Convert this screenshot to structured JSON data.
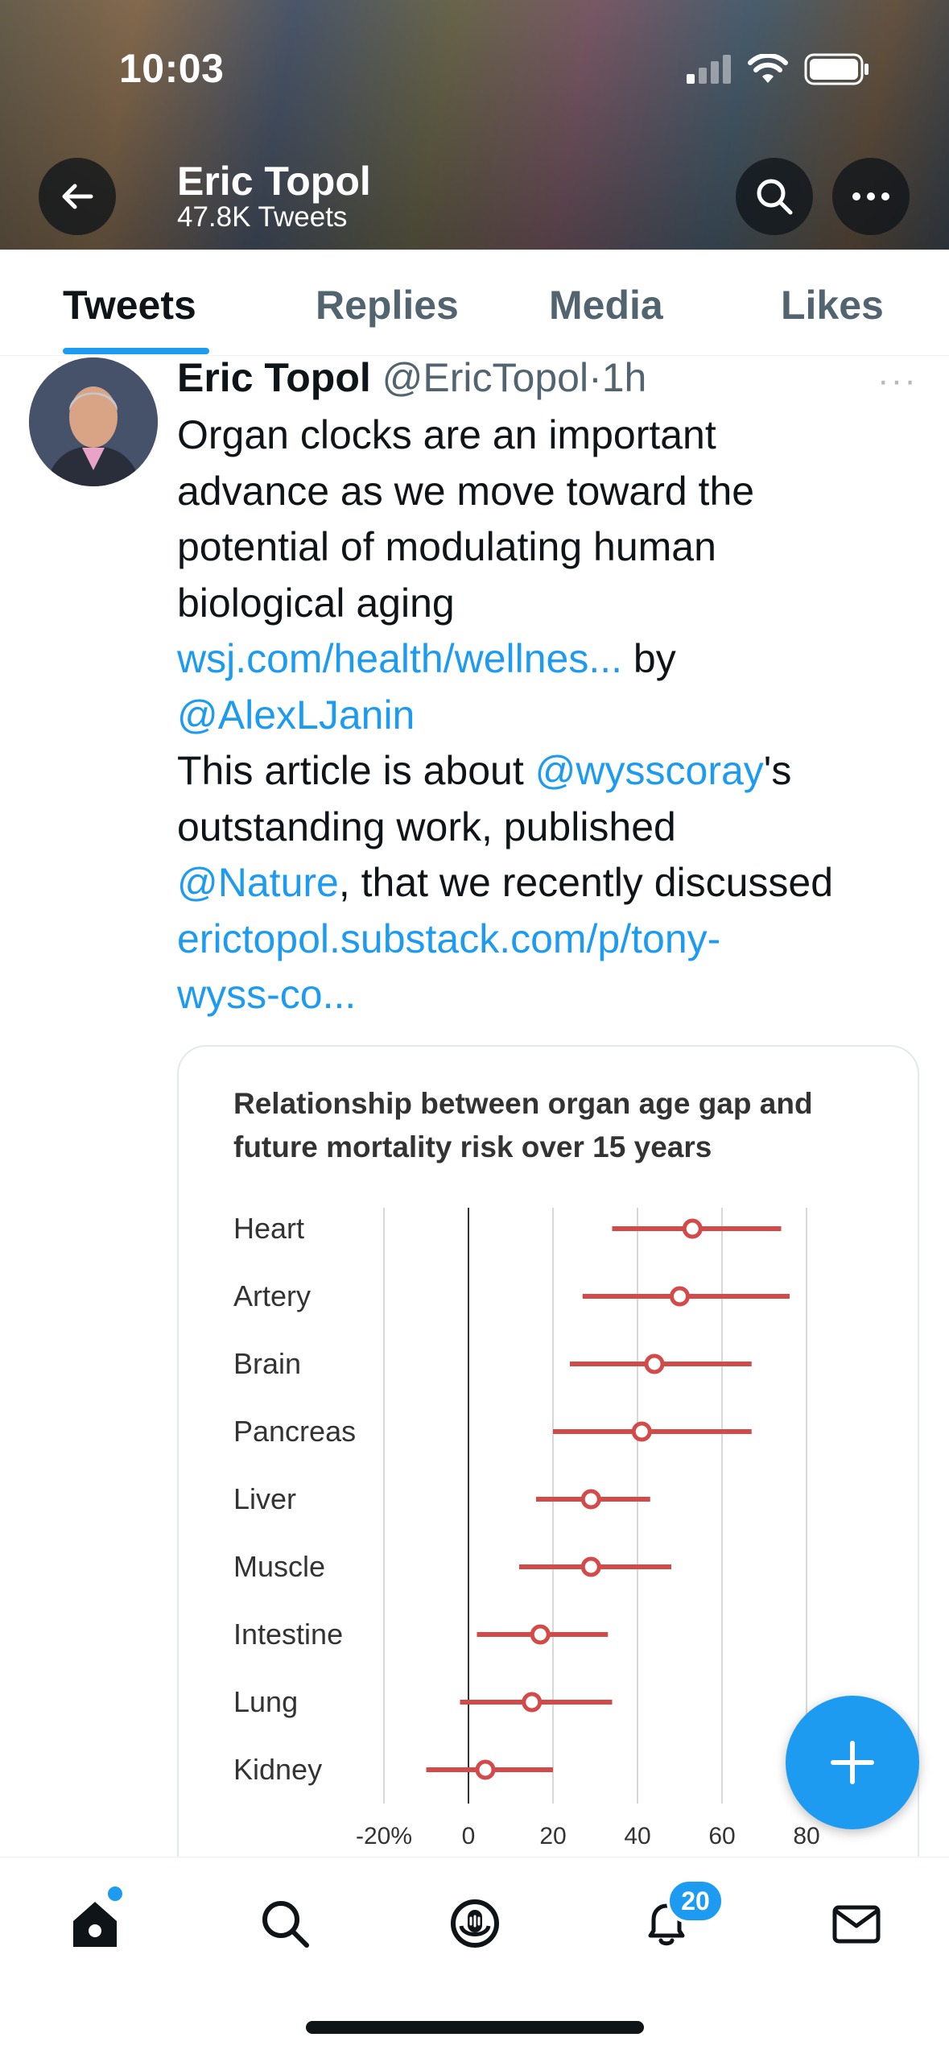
{
  "status_bar": {
    "time": "10:03"
  },
  "header": {
    "name": "Eric Topol",
    "subtitle": "47.8K Tweets"
  },
  "tabs": [
    {
      "label": "Tweets",
      "active": true
    },
    {
      "label": "Replies",
      "active": false
    },
    {
      "label": "Media",
      "active": false
    },
    {
      "label": "Likes",
      "active": false
    }
  ],
  "tweet": {
    "author_name": "Eric Topol",
    "handle": "@EricTopol",
    "separator": "·",
    "time": "1h",
    "more": "···",
    "lines": {
      "l1": "Organ clocks are an important",
      "l2": "advance as we move toward the",
      "l3": "potential of modulating human",
      "l4": "biological aging",
      "link1": "wsj.com/health/wellnes...",
      "by": " by",
      "mention1": "@AlexLJanin",
      "l7a": "This article is about ",
      "mention2": "@wysscoray",
      "l7b": "'s",
      "l8": "outstanding work, published",
      "mention3": "@Nature",
      "l9b": ", that we recently discussed",
      "link2a": "erictopol.substack.com/p/tony-",
      "link2b": "wyss-co..."
    }
  },
  "chart_data": {
    "type": "forest",
    "title": "Relationship between organ age gap and future mortality risk over 15 years",
    "title_lines": [
      "Relationship between organ age gap and",
      "future mortality risk over 15 years"
    ],
    "xlabel": "",
    "ylabel": "",
    "xlim": [
      -20,
      80
    ],
    "x_ticks": [
      -20,
      0,
      20,
      40,
      60,
      80
    ],
    "x_tick_labels": [
      "-20%",
      "0",
      "20",
      "40",
      "60",
      "80"
    ],
    "grid": true,
    "color": "#d24a4a",
    "categories": [
      "Heart",
      "Artery",
      "Brain",
      "Pancreas",
      "Liver",
      "Muscle",
      "Intestine",
      "Lung",
      "Kidney"
    ],
    "estimate": [
      53,
      50,
      44,
      41,
      29,
      29,
      17,
      15,
      4
    ],
    "ci_low": [
      34,
      27,
      24,
      20,
      16,
      12,
      2,
      -2,
      -10
    ],
    "ci_high": [
      74,
      76,
      67,
      67,
      43,
      48,
      33,
      34,
      20
    ]
  },
  "bottom_nav": {
    "notifications_badge": "20"
  },
  "icons": [
    "back-arrow-icon",
    "search-icon",
    "more-icon",
    "compose-plus-icon",
    "home-icon",
    "explore-search-icon",
    "spaces-icon",
    "notifications-bell-icon",
    "messages-envelope-icon"
  ],
  "colors": {
    "accent": "#1d9bf0",
    "text": "#0f1419",
    "muted": "#536471",
    "chart_red": "#d24a4a"
  }
}
